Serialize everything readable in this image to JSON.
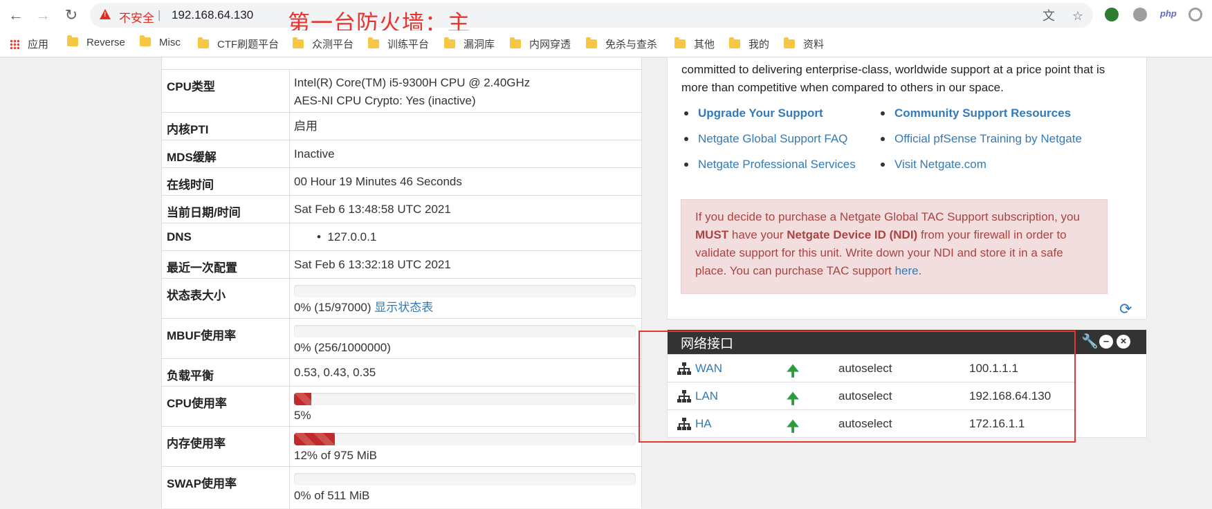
{
  "browser": {
    "security_label": "不安全",
    "separator": "|",
    "url": "192.168.64.130",
    "overlay_title": "第一台防火墙：主",
    "ext_php": "php"
  },
  "bookmarks": [
    {
      "label": "应用",
      "icon": "apps-grid-icon"
    },
    {
      "label": "Reverse",
      "icon": "folder-icon"
    },
    {
      "label": "Misc",
      "icon": "folder-icon"
    },
    {
      "label": "CTF刷题平台",
      "icon": "folder-icon"
    },
    {
      "label": "众测平台",
      "icon": "folder-icon"
    },
    {
      "label": "训练平台",
      "icon": "folder-icon"
    },
    {
      "label": "漏洞库",
      "icon": "folder-icon"
    },
    {
      "label": "内网穿透",
      "icon": "folder-icon"
    },
    {
      "label": "免杀与查杀",
      "icon": "folder-icon"
    },
    {
      "label": "其他",
      "icon": "folder-icon"
    },
    {
      "label": "我的",
      "icon": "folder-icon"
    },
    {
      "label": "资料",
      "icon": "folder-icon"
    }
  ],
  "system_info": {
    "cpu_type_label": "CPU类型",
    "cpu_type_line1": "Intel(R) Core(TM) i5-9300H CPU @ 2.40GHz",
    "cpu_type_line2": "AES-NI CPU Crypto: Yes (inactive)",
    "kernel_pti_label": "内核PTI",
    "kernel_pti_value": "启用",
    "mds_label": "MDS缓解",
    "mds_value": "Inactive",
    "uptime_label": "在线时间",
    "uptime_value": "00 Hour 19 Minutes 46 Seconds",
    "datetime_label": "当前日期/时间",
    "datetime_value": "Sat Feb 6 13:48:58 UTC 2021",
    "dns_label": "DNS",
    "dns_value": "127.0.0.1",
    "last_config_label": "最近一次配置",
    "last_config_value": "Sat Feb 6 13:32:18 UTC 2021",
    "state_table_label": "状态表大小",
    "state_table_value": "0% (15/97000)",
    "state_table_link": "显示状态表",
    "state_table_percent": 0,
    "mbuf_label": "MBUF使用率",
    "mbuf_value": "0% (256/1000000)",
    "mbuf_percent": 0,
    "load_label": "负载平衡",
    "load_value": "0.53, 0.43, 0.35",
    "cpu_usage_label": "CPU使用率",
    "cpu_usage_value": "5%",
    "cpu_usage_percent": 5,
    "mem_label": "内存使用率",
    "mem_value": "12% of 975 MiB",
    "mem_percent": 12,
    "swap_label": "SWAP使用率",
    "swap_value": "0% of 511 MiB",
    "swap_percent": 0
  },
  "support": {
    "intro": "committed to delivering enterprise-class, worldwide support at a price point that is more than competitive when compared to others in our space.",
    "links_left": [
      "Upgrade Your Support",
      "Netgate Global Support FAQ",
      "Netgate Professional Services"
    ],
    "links_right": [
      "Community Support Resources",
      "Official pfSense Training by Netgate",
      "Visit Netgate.com"
    ],
    "alert_part1": "If you decide to purchase a Netgate Global TAC Support subscription, you ",
    "alert_must": "MUST",
    "alert_part2": " have your ",
    "alert_ndi": "Netgate Device ID (NDI)",
    "alert_part3": " from your firewall in order to validate support for this unit. Write down your NDI and store it in a safe place. You can purchase TAC support ",
    "alert_link": "here",
    "alert_end": "."
  },
  "interfaces": {
    "title": "网络接口",
    "rows": [
      {
        "name": "WAN",
        "media": "autoselect",
        "ip": "100.1.1.1",
        "status": "up"
      },
      {
        "name": "LAN",
        "media": "autoselect",
        "ip": "192.168.64.130",
        "status": "up"
      },
      {
        "name": "HA",
        "media": "autoselect",
        "ip": "172.16.1.1",
        "status": "up"
      }
    ]
  },
  "colors": {
    "danger": "#c12a2a",
    "link": "#337ab7",
    "status_up": "#2d9c3f",
    "annotation_red": "#e8332f"
  }
}
